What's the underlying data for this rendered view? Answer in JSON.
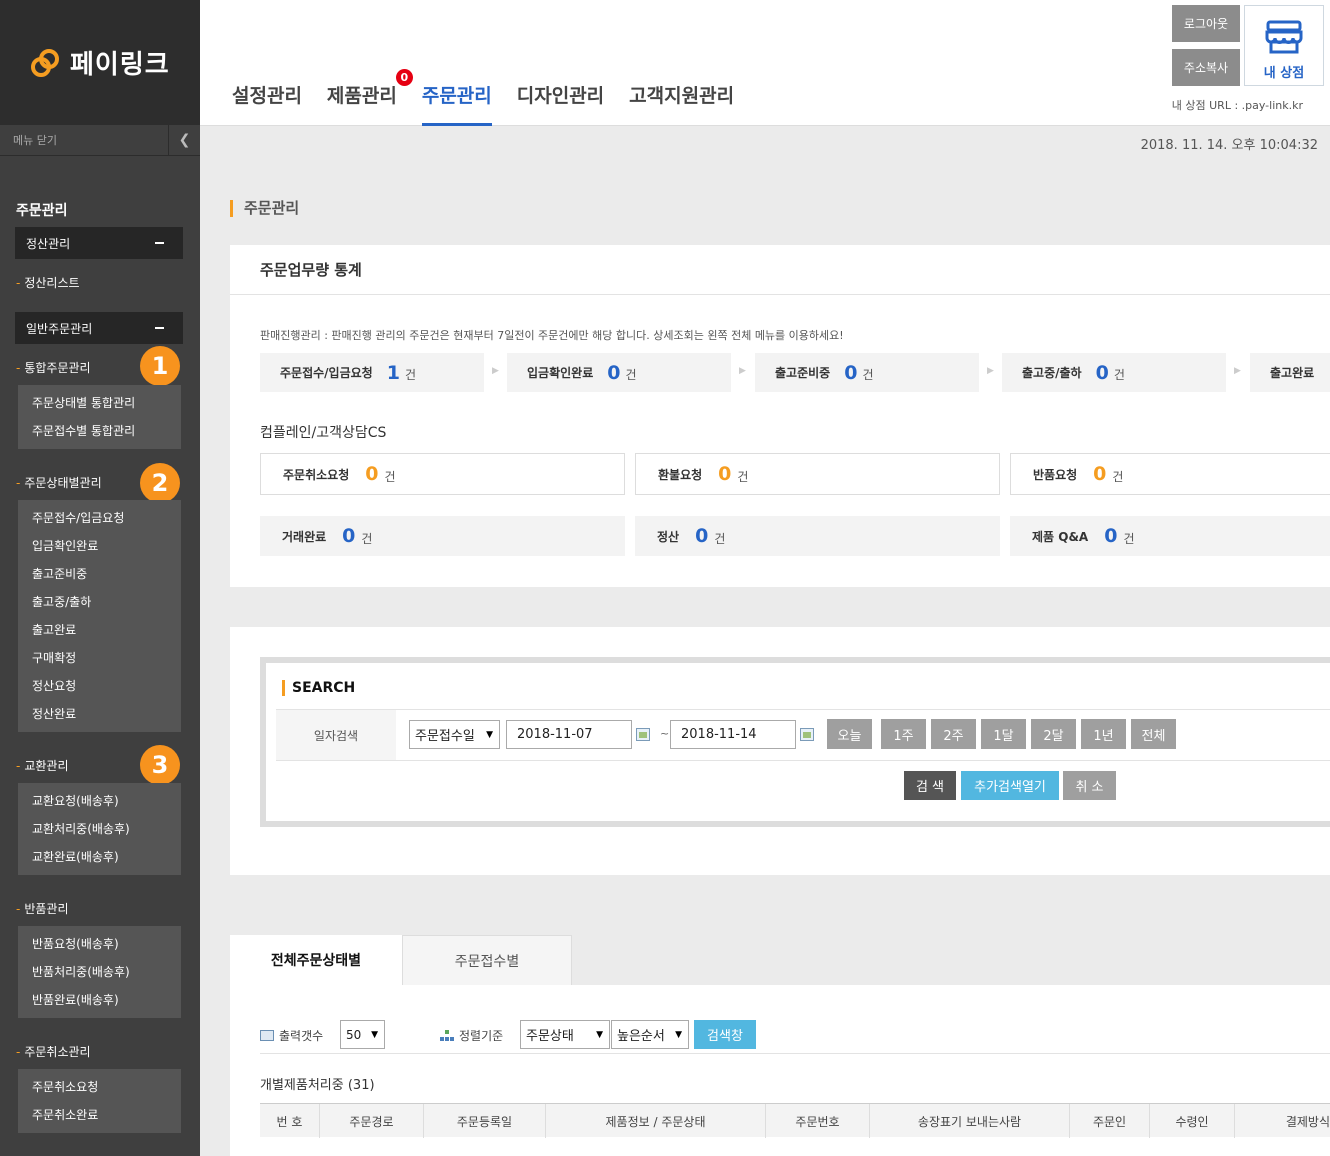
{
  "brand": {
    "name": "페이링크"
  },
  "sidebar": {
    "close_label": "메뉴 닫기",
    "section_title": "주문관리",
    "box_settlement": "정산관리",
    "settlement_list": "정산리스트",
    "box_general": "일반주문관리",
    "cat_integrated": "통합주문관리",
    "integrated_items": [
      "주문상태별 통합관리",
      "주문접수별 통합관리"
    ],
    "cat_status": "주문상태별관리",
    "status_items": [
      "주문접수/입금요청",
      "입금확인완료",
      "출고준비중",
      "출고중/출하",
      "출고완료",
      "구매확정",
      "정산요청",
      "정산완료"
    ],
    "cat_exchange": "교환관리",
    "exchange_items": [
      "교환요청(배송후)",
      "교환처리중(배송후)",
      "교환완료(배송후)"
    ],
    "cat_return": "반품관리",
    "return_items": [
      "반품요청(배송후)",
      "반품처리중(배송후)",
      "반품완료(배송후)"
    ],
    "cat_cancel": "주문취소관리",
    "cancel_items": [
      "주문취소요청",
      "주문취소완료"
    ],
    "badges": [
      "1",
      "2",
      "3"
    ]
  },
  "nav": {
    "items": [
      "설정관리",
      "제품관리",
      "주문관리",
      "디자인관리",
      "고객지원관리"
    ],
    "product_badge": "0"
  },
  "header": {
    "logout": "로그아웃",
    "copy_address": "주소복사",
    "my_shop": "내 상점",
    "shop_url": "내 상점 URL : .pay-link.kr",
    "datetime": "2018. 11. 14. 오후 10:04:32"
  },
  "page_title": "주문관리",
  "stats": {
    "title": "주문업무량 통계",
    "note": "판매진행관리 : 판매진행 관리의 주문건은 현재부터 7일전이 주문건에만 해당 합니다. 상세조회는 왼쪽 전체 메뉴를 이용하세요!",
    "unit": "건",
    "flow": [
      {
        "label": "주문접수/입금요청",
        "count": "1"
      },
      {
        "label": "입금확인완료",
        "count": "0"
      },
      {
        "label": "출고준비중",
        "count": "0"
      },
      {
        "label": "출고중/출하",
        "count": "0"
      },
      {
        "label": "출고완료",
        "count": ""
      }
    ],
    "cs_title": "컴플레인/고객상담CS",
    "cs_row1": [
      {
        "label": "주문취소요청",
        "count": "0"
      },
      {
        "label": "환불요청",
        "count": "0"
      },
      {
        "label": "반품요청",
        "count": "0"
      }
    ],
    "cs_row2": [
      {
        "label": "거래완료",
        "count": "0"
      },
      {
        "label": "정산",
        "count": "0"
      },
      {
        "label": "제품 Q&A",
        "count": "0"
      }
    ]
  },
  "search": {
    "title": "SEARCH",
    "date_label": "일자검색",
    "date_type": "주문접수일",
    "date_from": "2018-11-07",
    "tilde": "~",
    "date_to": "2018-11-14",
    "periods": [
      "오늘",
      "1주",
      "2주",
      "1달",
      "2달",
      "1년",
      "전체"
    ],
    "btn_search": "검 색",
    "btn_more": "추가검색열기",
    "btn_cancel": "취 소"
  },
  "list": {
    "tabs": [
      "전체주문상태별",
      "주문접수별"
    ],
    "output_label": "출력갯수",
    "output_value": "50",
    "sort_label": "정렬기준",
    "sort_field": "주문상태",
    "sort_order": "높은순서",
    "btn_search": "검색창",
    "processing": "개별제품처리중 (31)",
    "columns": [
      "번 호",
      "주문경로",
      "주문등록일",
      "제품정보 / 주문상태",
      "주문번호",
      "송장표기 보내는사람",
      "주문인",
      "수령인",
      "결제방식"
    ]
  },
  "colors": {
    "accent": "#2664c6",
    "orange": "#f59d21",
    "sidebar_bg": "#3f3f3f"
  }
}
